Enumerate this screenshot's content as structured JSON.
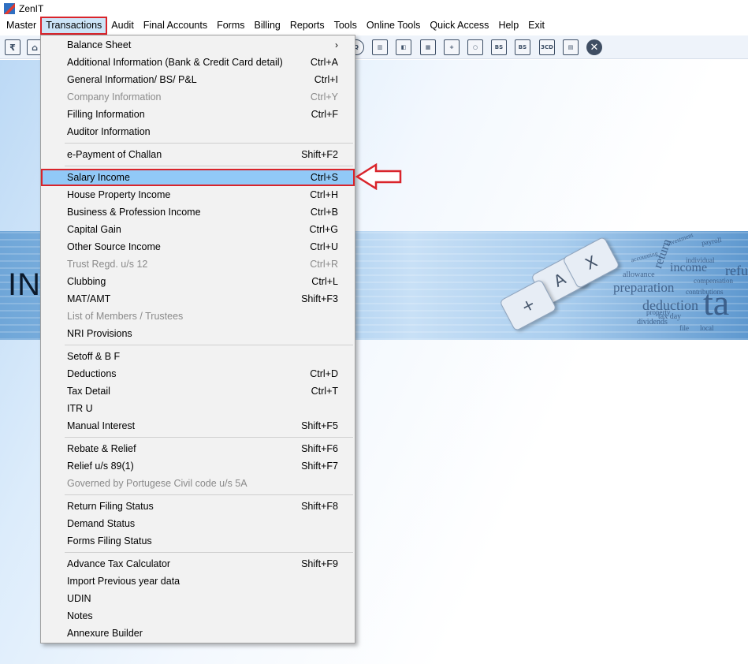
{
  "window": {
    "title": "ZenIT"
  },
  "menubar": [
    "Master",
    "Transactions",
    "Audit",
    "Final Accounts",
    "Forms",
    "Billing",
    "Reports",
    "Tools",
    "Online Tools",
    "Quick Access",
    "Help",
    "Exit"
  ],
  "toolbar": {
    "left_icons": [
      "rupee-book-icon",
      "home-icon"
    ],
    "right_icons": [
      {
        "name": "search-icon",
        "glyph": "Q"
      },
      {
        "name": "bar-chart-icon",
        "glyph": "▥"
      },
      {
        "name": "user-document-icon",
        "glyph": "◧"
      },
      {
        "name": "calendar-icon",
        "glyph": "▦"
      },
      {
        "name": "add-document-icon",
        "glyph": "+"
      },
      {
        "name": "search-document-icon",
        "glyph": "○"
      },
      {
        "name": "bs-icon",
        "glyph": "BS"
      },
      {
        "name": "bs-sch-icon",
        "glyph": "BS"
      },
      {
        "name": "3cd-icon",
        "glyph": "3CD"
      },
      {
        "name": "report-icon",
        "glyph": "▤"
      },
      {
        "name": "close-icon",
        "glyph": "✕"
      }
    ]
  },
  "banner": {
    "title": "INC",
    "words": [
      "payroll",
      "income",
      "refu",
      "preparation",
      "deduction",
      "tax day",
      "dividends",
      "return",
      "allowance",
      "compensation",
      "property",
      "file",
      "local",
      "individual",
      "accounting",
      "investment",
      "contributions",
      "ta"
    ]
  },
  "dropdown": {
    "groups": [
      [
        {
          "label": "Balance Sheet",
          "shortcut": "",
          "submenu": true,
          "disabled": false
        },
        {
          "label": "Additional Information (Bank & Credit Card detail)",
          "shortcut": "Ctrl+A",
          "disabled": false
        },
        {
          "label": "General Information/ BS/ P&L",
          "shortcut": "Ctrl+I",
          "disabled": false
        },
        {
          "label": "Company Information",
          "shortcut": "Ctrl+Y",
          "disabled": true
        },
        {
          "label": "Filling Information",
          "shortcut": "Ctrl+F",
          "disabled": false
        },
        {
          "label": "Auditor Information",
          "shortcut": "",
          "disabled": false
        }
      ],
      [
        {
          "label": "e-Payment of Challan",
          "shortcut": "Shift+F2",
          "disabled": false
        }
      ],
      [
        {
          "label": "Salary Income",
          "shortcut": "Ctrl+S",
          "disabled": false,
          "selected": true
        },
        {
          "label": "House Property Income",
          "shortcut": "Ctrl+H",
          "disabled": false
        },
        {
          "label": "Business & Profession Income",
          "shortcut": "Ctrl+B",
          "disabled": false
        },
        {
          "label": "Capital Gain",
          "shortcut": "Ctrl+G",
          "disabled": false
        },
        {
          "label": "Other Source Income",
          "shortcut": "Ctrl+U",
          "disabled": false
        },
        {
          "label": "Trust Regd. u/s 12",
          "shortcut": "Ctrl+R",
          "disabled": true
        },
        {
          "label": "Clubbing",
          "shortcut": "Ctrl+L",
          "disabled": false
        },
        {
          "label": "MAT/AMT",
          "shortcut": "Shift+F3",
          "disabled": false
        },
        {
          "label": "List of Members / Trustees",
          "shortcut": "",
          "disabled": true
        },
        {
          "label": "NRI Provisions",
          "shortcut": "",
          "disabled": false
        }
      ],
      [
        {
          "label": "Setoff & B F",
          "shortcut": "",
          "disabled": false
        },
        {
          "label": "Deductions",
          "shortcut": "Ctrl+D",
          "disabled": false
        },
        {
          "label": "Tax Detail",
          "shortcut": "Ctrl+T",
          "disabled": false
        },
        {
          "label": "ITR U",
          "shortcut": "",
          "disabled": false
        },
        {
          "label": "Manual Interest",
          "shortcut": "Shift+F5",
          "disabled": false
        }
      ],
      [
        {
          "label": "Rebate & Relief",
          "shortcut": "Shift+F6",
          "disabled": false
        },
        {
          "label": "Relief u/s 89(1)",
          "shortcut": "Shift+F7",
          "disabled": false
        },
        {
          "label": "Governed by Portugese Civil code u/s 5A",
          "shortcut": "",
          "disabled": true
        }
      ],
      [
        {
          "label": "Return Filing Status",
          "shortcut": "Shift+F8",
          "disabled": false
        },
        {
          "label": "Demand Status",
          "shortcut": "",
          "disabled": false
        },
        {
          "label": "Forms Filing Status",
          "shortcut": "",
          "disabled": false
        }
      ],
      [
        {
          "label": "Advance Tax Calculator",
          "shortcut": "Shift+F9",
          "disabled": false
        },
        {
          "label": "Import Previous year data",
          "shortcut": "",
          "disabled": false
        },
        {
          "label": "UDIN",
          "shortcut": "",
          "disabled": false
        },
        {
          "label": "Notes",
          "shortcut": "",
          "disabled": false
        },
        {
          "label": "Annexure Builder",
          "shortcut": "",
          "disabled": false
        }
      ]
    ],
    "submenu_arrow": "›"
  },
  "colors": {
    "highlight_red": "#d9242b",
    "selected_bg": "#91c9f7",
    "menu_open_bg": "#cce4f7"
  }
}
